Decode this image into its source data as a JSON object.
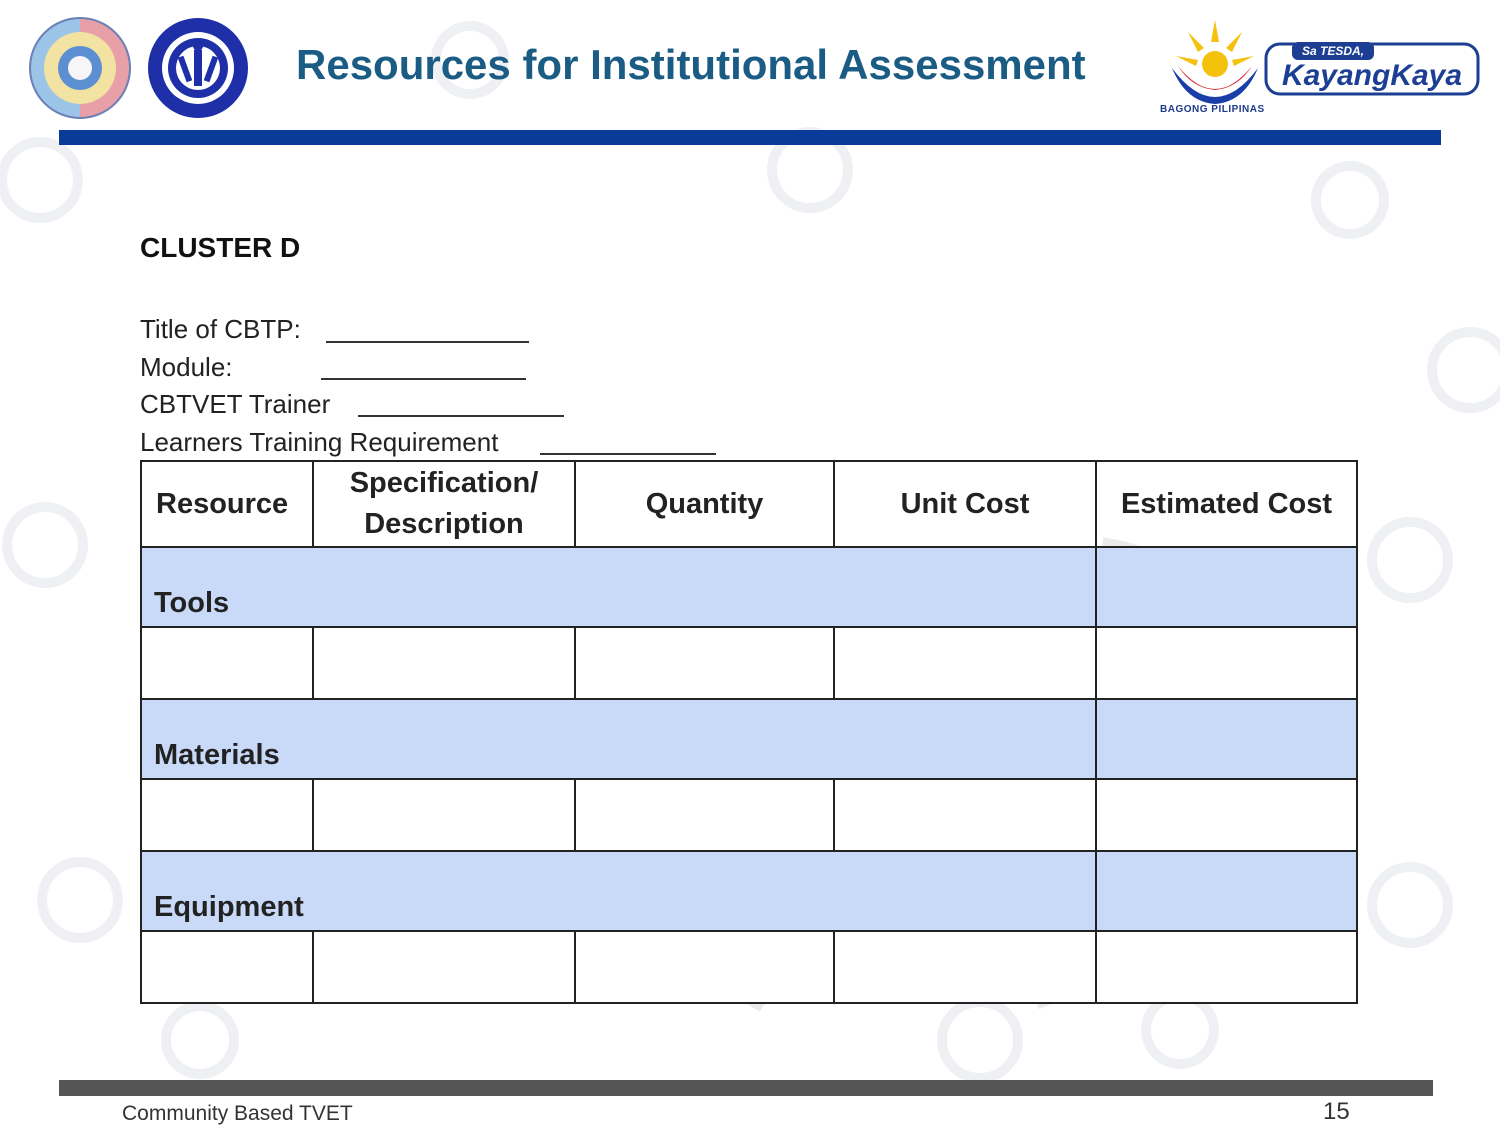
{
  "header": {
    "title": "Resources for Institutional Assessment",
    "bagong_label": "BAGONG PILIPINAS",
    "tesda_badge_top": "Sa TESDA,",
    "tesda_badge_main": "KayangKaya",
    "bar_color": "#0b3b99"
  },
  "form": {
    "cluster": "CLUSTER D",
    "fields": [
      {
        "label": "Title of CBTP:"
      },
      {
        "label": "Module:"
      },
      {
        "label": "CBTVET Trainer"
      },
      {
        "label": "Learners Training Requirement"
      }
    ]
  },
  "table": {
    "headers": [
      "Resource",
      "Specification/ Description",
      "Quantity",
      "Unit Cost",
      "Estimated Cost"
    ],
    "categories": [
      "Tools",
      "Materials",
      "Equipment"
    ],
    "category_row_color": "#c9daf8"
  },
  "footer": {
    "text": "Community Based TVET",
    "page": "15",
    "bar_color": "#555555"
  },
  "icons": {
    "left_logo": "cbtvet-wheel-logo",
    "tesda_logo": "tesda-seal-logo",
    "bagong_logo": "bagong-pilipinas-logo",
    "tesda_badge": "sa-tesda-kayang-kaya-logo"
  }
}
